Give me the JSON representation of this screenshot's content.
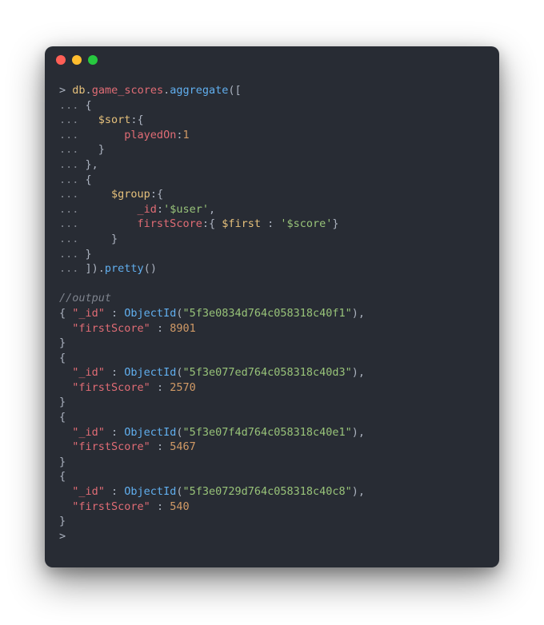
{
  "window": {
    "dots": [
      "red",
      "yellow",
      "green"
    ]
  },
  "code": {
    "db": "db",
    "collection": "game_scores",
    "aggregate": "aggregate",
    "sort": "$sort",
    "sortKey": "playedOn",
    "sortVal": "1",
    "group": "$group",
    "idKey": "_id",
    "idVal": "'$user'",
    "firstScoreKey": "firstScore",
    "firstOp": "$first",
    "firstArg": "'$score'",
    "pretty": "pretty",
    "cont": "...",
    "prompt": ">",
    "commentOutput": "//output"
  },
  "output": [
    {
      "id": "\"5f3e0834d764c058318c40f1\"",
      "firstScore": "8901"
    },
    {
      "id": "\"5f3e077ed764c058318c40d3\"",
      "firstScore": "2570"
    },
    {
      "id": "\"5f3e07f4d764c058318c40e1\"",
      "firstScore": "5467"
    },
    {
      "id": "\"5f3e0729d764c058318c40c8\"",
      "firstScore": "540"
    }
  ],
  "labels": {
    "objectId": "ObjectId",
    "idField": "\"_id\"",
    "firstScoreField": "\"firstScore\"",
    "openBrace": "{",
    "closeBrace": "}",
    "colon": " : ",
    "comma": ",",
    "openParen": "(",
    "closeParen": ")"
  }
}
